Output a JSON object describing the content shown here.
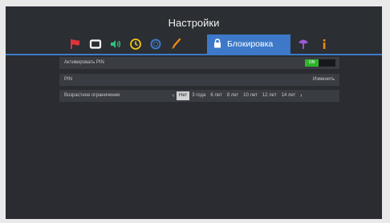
{
  "header": {
    "title": "Настройки"
  },
  "tabs": [
    {
      "icon": "flag-icon"
    },
    {
      "icon": "screen-icon"
    },
    {
      "icon": "sound-icon"
    },
    {
      "icon": "clock-icon"
    },
    {
      "icon": "refresh-icon"
    },
    {
      "icon": "brush-icon"
    },
    {
      "icon": "lock-icon",
      "label": "Блокировка",
      "active": true
    },
    {
      "icon": "satellite-icon"
    },
    {
      "icon": "info-icon"
    }
  ],
  "settings": {
    "activate_pin": {
      "label": "Активировать PIN",
      "toggle": "ON"
    },
    "pin": {
      "label": "PIN",
      "value": "Изменить"
    },
    "age_limit": {
      "label": "Возрастное ограничение",
      "options": [
        "Нет",
        "3 года",
        "6 лет",
        "8 лет",
        "10 лет",
        "12 лет",
        "14 лет"
      ],
      "selected": "Нет"
    }
  },
  "colors": {
    "accent": "#3d79c8",
    "toggle_on": "#2fb52c",
    "flag": "#e0333b",
    "sound": "#2ec27b",
    "clock": "#f0c419",
    "refresh": "#3d79c8",
    "brush": "#ef8a1c",
    "satellite": "#9c5ad6",
    "info": "#f08a12"
  }
}
